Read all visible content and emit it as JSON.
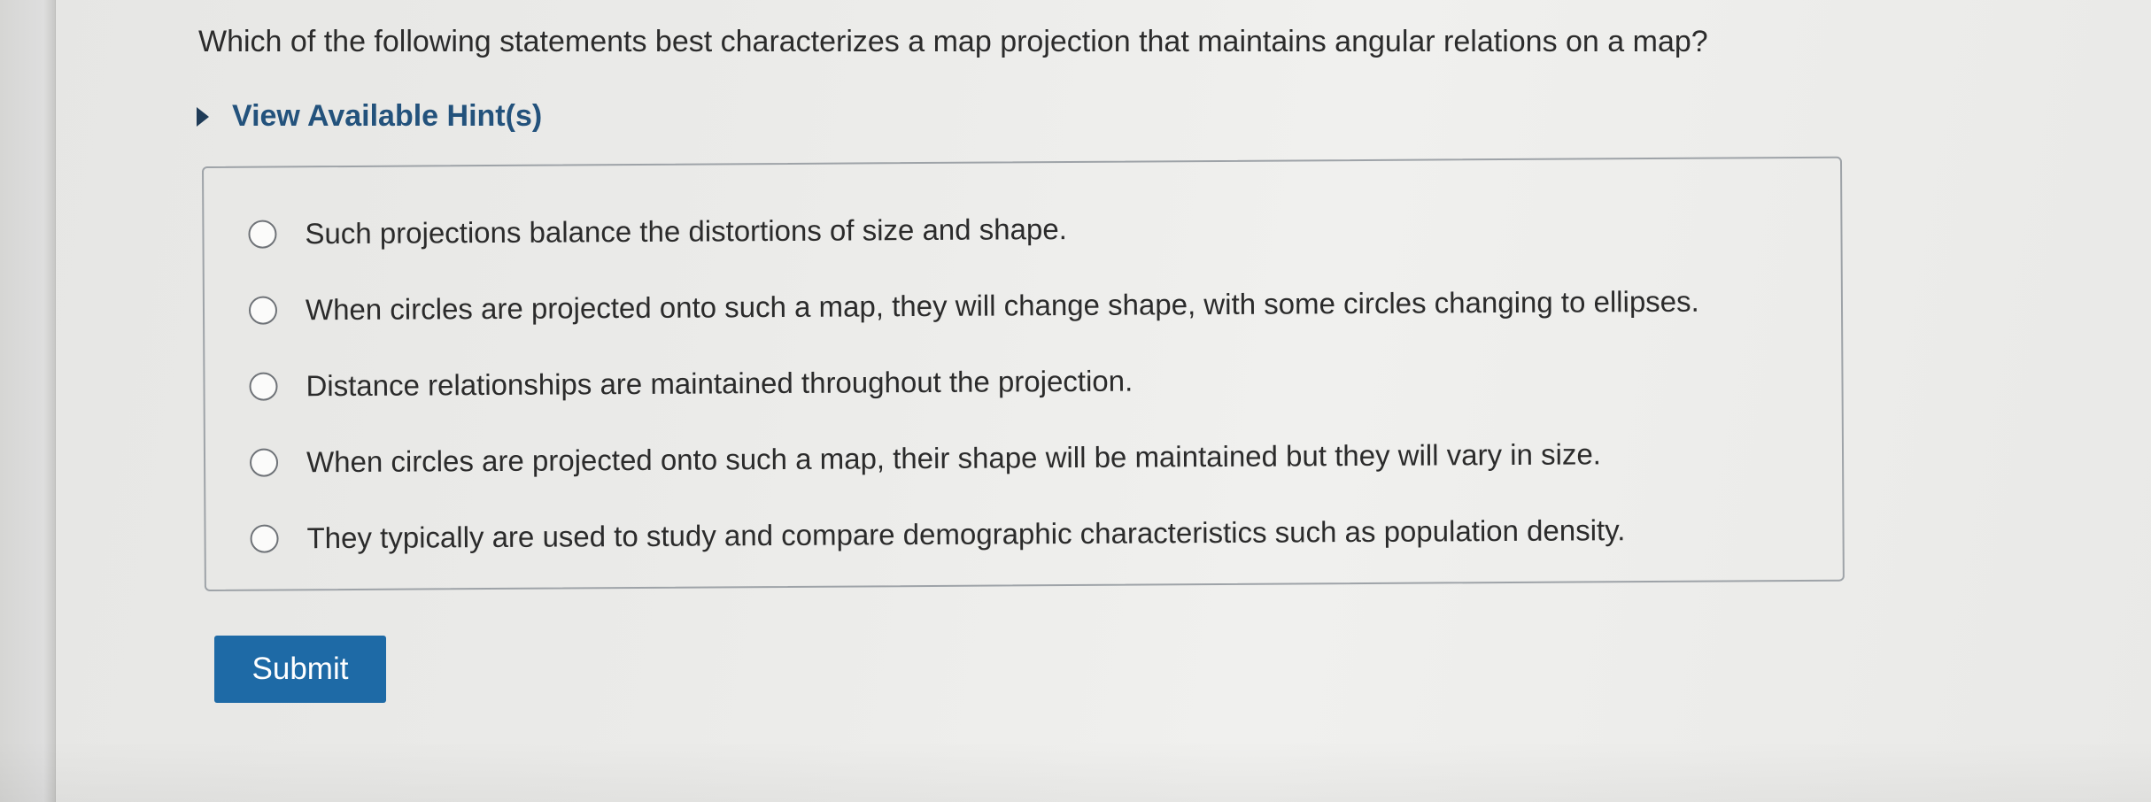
{
  "question": {
    "text": "Which of the following statements best characterizes a map projection that maintains angular relations on a map?"
  },
  "hint": {
    "label": "View Available Hint(s)",
    "expanded": false
  },
  "options": [
    {
      "label": "Such projections balance the distortions of size and shape.",
      "selected": false
    },
    {
      "label": "When circles are projected onto such a map, they will change shape, with some circles changing to ellipses.",
      "selected": false
    },
    {
      "label": "Distance relationships are maintained throughout the projection.",
      "selected": false
    },
    {
      "label": "When circles are projected onto such a map, their shape will be maintained but they will vary in size.",
      "selected": false
    },
    {
      "label": "They typically are used to study and compare demographic characteristics such as population density.",
      "selected": false
    }
  ],
  "submit": {
    "label": "Submit"
  },
  "colors": {
    "accent": "#1e6aa6",
    "hint_text": "#23527c"
  }
}
